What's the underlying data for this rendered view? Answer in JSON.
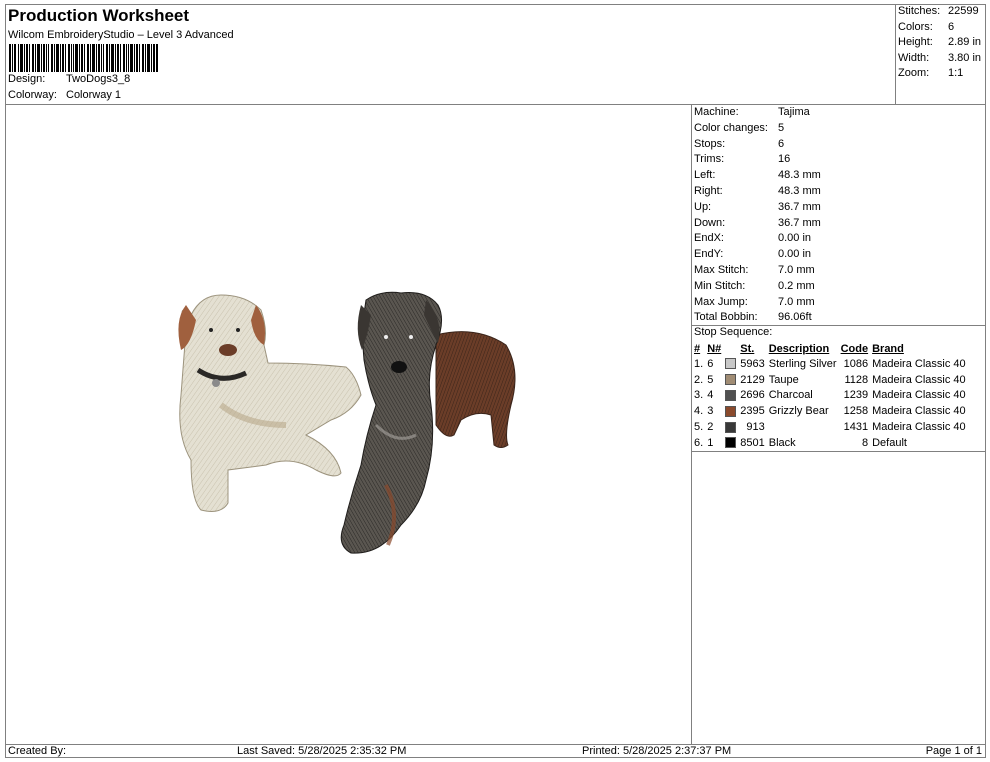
{
  "header": {
    "title": "Production Worksheet",
    "subtitle": "Wilcom EmbroideryStudio – Level 3 Advanced",
    "design_label": "Design:",
    "design_value": "TwoDogs3_8",
    "colorway_label": "Colorway:",
    "colorway_value": "Colorway 1"
  },
  "summary": [
    {
      "label": "Stitches:",
      "value": "22599"
    },
    {
      "label": "Colors:",
      "value": "6"
    },
    {
      "label": "Height:",
      "value": "2.89 in"
    },
    {
      "label": "Width:",
      "value": "3.80 in"
    },
    {
      "label": "Zoom:",
      "value": "1:1"
    }
  ],
  "machine_info": [
    {
      "label": "Machine:",
      "value": "Tajima"
    },
    {
      "label": "Color changes:",
      "value": "5"
    },
    {
      "label": "Stops:",
      "value": "6"
    },
    {
      "label": "Trims:",
      "value": "16"
    },
    {
      "label": "Left:",
      "value": "48.3 mm"
    },
    {
      "label": "Right:",
      "value": "48.3 mm"
    },
    {
      "label": "Up:",
      "value": "36.7 mm"
    },
    {
      "label": "Down:",
      "value": "36.7 mm"
    },
    {
      "label": "EndX:",
      "value": "0.00 in"
    },
    {
      "label": "EndY:",
      "value": "0.00 in"
    },
    {
      "label": "Max Stitch:",
      "value": "7.0 mm"
    },
    {
      "label": "Min Stitch:",
      "value": "0.2 mm"
    },
    {
      "label": "Max Jump:",
      "value": "7.0 mm"
    },
    {
      "label": "Total Bobbin:",
      "value": "96.06ft"
    }
  ],
  "stop_sequence": {
    "title": "Stop Sequence:",
    "headers": [
      "#",
      "N#",
      "St.",
      "Description",
      "Code",
      "Brand"
    ],
    "rows": [
      {
        "idx": "1.",
        "n": "6",
        "color": "#c8c8c8",
        "st": "5963",
        "desc": "Sterling Silver",
        "code": "1086",
        "brand": "Madeira Classic 40"
      },
      {
        "idx": "2.",
        "n": "5",
        "color": "#a08c74",
        "st": "2129",
        "desc": "Taupe",
        "code": "1128",
        "brand": "Madeira Classic 40"
      },
      {
        "idx": "3.",
        "n": "4",
        "color": "#505050",
        "st": "2696",
        "desc": "Charcoal",
        "code": "1239",
        "brand": "Madeira Classic 40"
      },
      {
        "idx": "4.",
        "n": "3",
        "color": "#8a4a2c",
        "st": "2395",
        "desc": "Grizzly Bear",
        "code": "1258",
        "brand": "Madeira Classic 40"
      },
      {
        "idx": "5.",
        "n": "2",
        "color": "#383838",
        "st": "913",
        "desc": "",
        "code": "1431",
        "brand": "Madeira Classic 40"
      },
      {
        "idx": "6.",
        "n": "1",
        "color": "#000000",
        "st": "8501",
        "desc": "Black",
        "code": "8",
        "brand": "Default"
      }
    ]
  },
  "footer": {
    "created_by": "Created By:",
    "last_saved": "Last Saved: 5/28/2025 2:35:32 PM",
    "printed": "Printed: 5/28/2025 2:37:37 PM",
    "page": "Page 1 of 1"
  }
}
